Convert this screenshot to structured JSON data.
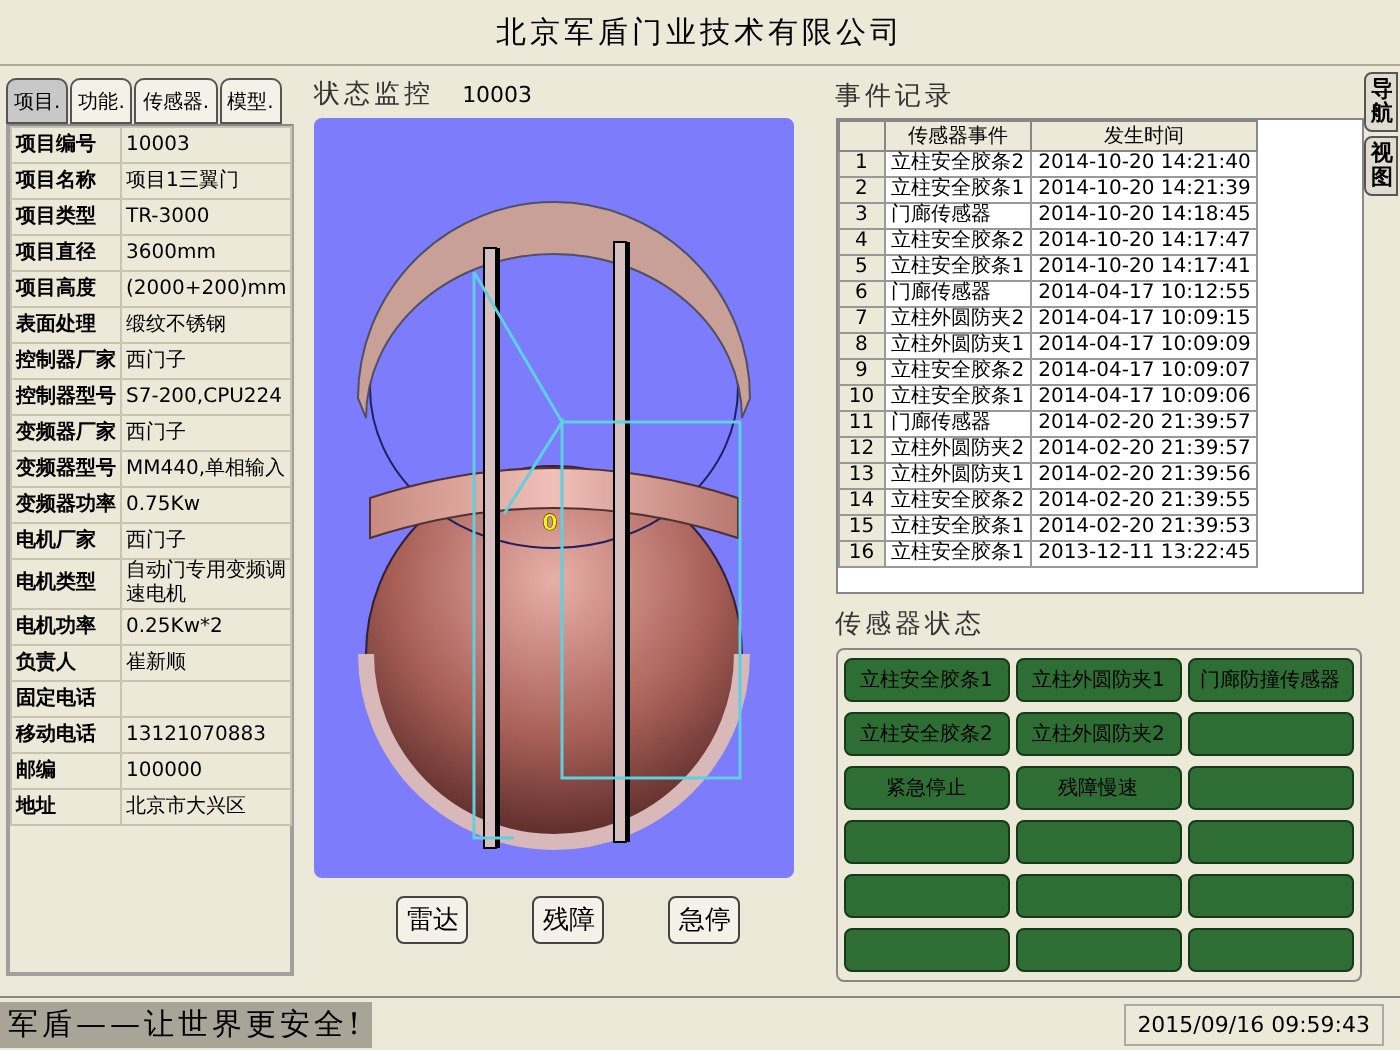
{
  "window": {
    "title": "北京军盾门业技术有限公司"
  },
  "tabs": [
    {
      "label": "项目.",
      "selected": true
    },
    {
      "label": "功能.",
      "selected": false
    },
    {
      "label": "传感器.",
      "selected": false
    },
    {
      "label": "模型.",
      "selected": false
    }
  ],
  "project_info": [
    {
      "label": "项目编号",
      "value": "10003"
    },
    {
      "label": "项目名称",
      "value": "项目1三翼门"
    },
    {
      "label": "项目类型",
      "value": "TR-3000"
    },
    {
      "label": "项目直径",
      "value": "3600mm"
    },
    {
      "label": "项目高度",
      "value": "(2000+200)mm"
    },
    {
      "label": "表面处理",
      "value": "缎纹不锈钢"
    },
    {
      "label": "控制器厂家",
      "value": "西门子"
    },
    {
      "label": "控制器型号",
      "value": "S7-200,CPU224"
    },
    {
      "label": "变频器厂家",
      "value": "西门子"
    },
    {
      "label": "变频器型号",
      "value": "MM440,单相输入"
    },
    {
      "label": "变频器功率",
      "value": "0.75Kw"
    },
    {
      "label": "电机厂家",
      "value": "西门子"
    },
    {
      "label": "电机类型",
      "value": "自动门专用变频调速电机"
    },
    {
      "label": "电机功率",
      "value": "0.25Kw*2"
    },
    {
      "label": "负责人",
      "value": "崔新顺"
    },
    {
      "label": "固定电话"
    },
    {
      "label": "移动电话",
      "value": "13121070883"
    },
    {
      "label": "邮编",
      "value": "100000"
    },
    {
      "label": "地址",
      "value": "北京市大兴区"
    }
  ],
  "monitor": {
    "title": "状态监控",
    "project_number": "10003",
    "door_value": "0",
    "buttons": [
      "雷达",
      "残障",
      "急停"
    ]
  },
  "events": {
    "title": "事件记录",
    "columns": [
      "",
      "传感器事件",
      "发生时间"
    ],
    "rows": [
      [
        "1",
        "立柱安全胶条2",
        "2014-10-20 14:21:40"
      ],
      [
        "2",
        "立柱安全胶条1",
        "2014-10-20 14:21:39"
      ],
      [
        "3",
        "门廊传感器",
        "2014-10-20 14:18:45"
      ],
      [
        "4",
        "立柱安全胶条2",
        "2014-10-20 14:17:47"
      ],
      [
        "5",
        "立柱安全胶条1",
        "2014-10-20 14:17:41"
      ],
      [
        "6",
        "门廊传感器",
        "2014-04-17 10:12:55"
      ],
      [
        "7",
        "立柱外圆防夹2",
        "2014-04-17 10:09:15"
      ],
      [
        "8",
        "立柱外圆防夹1",
        "2014-04-17 10:09:09"
      ],
      [
        "9",
        "立柱安全胶条2",
        "2014-04-17 10:09:07"
      ],
      [
        "10",
        "立柱安全胶条1",
        "2014-04-17 10:09:06"
      ],
      [
        "11",
        "门廊传感器",
        "2014-02-20 21:39:57"
      ],
      [
        "12",
        "立柱外圆防夹2",
        "2014-02-20 21:39:57"
      ],
      [
        "13",
        "立柱外圆防夹1",
        "2014-02-20 21:39:56"
      ],
      [
        "14",
        "立柱安全胶条2",
        "2014-02-20 21:39:55"
      ],
      [
        "15",
        "立柱安全胶条1",
        "2014-02-20 21:39:53"
      ],
      [
        "16",
        "立柱安全胶条1",
        "2013-12-11 13:22:45"
      ]
    ]
  },
  "sensor_status": {
    "title": "传感器状态",
    "indicators": [
      {
        "kind": "labeled",
        "label": "立柱安全胶条1"
      },
      {
        "kind": "labeled",
        "label": "立柱外圆防夹1"
      },
      {
        "kind": "labeled",
        "label": "门廊防撞传感器"
      },
      {
        "kind": "labeled",
        "label": "立柱安全胶条2"
      },
      {
        "kind": "labeled",
        "label": "立柱外圆防夹2"
      },
      {
        "kind": "blank"
      },
      {
        "kind": "labeled",
        "label": "紧急停止"
      },
      {
        "kind": "labeled",
        "label": "残障慢速"
      },
      {
        "kind": "blank"
      },
      {
        "kind": "blank"
      },
      {
        "kind": "blank"
      },
      {
        "kind": "blank"
      },
      {
        "kind": "blank"
      },
      {
        "kind": "blank"
      },
      {
        "kind": "blank"
      },
      {
        "kind": "blank"
      },
      {
        "kind": "blank"
      },
      {
        "kind": "blank"
      }
    ]
  },
  "side_tabs": [
    {
      "label": "导航"
    },
    {
      "label": "视图"
    }
  ],
  "status_bar": {
    "slogan": "军盾——让世界更安全!",
    "datetime": "2015/09/16  09:59:43"
  }
}
